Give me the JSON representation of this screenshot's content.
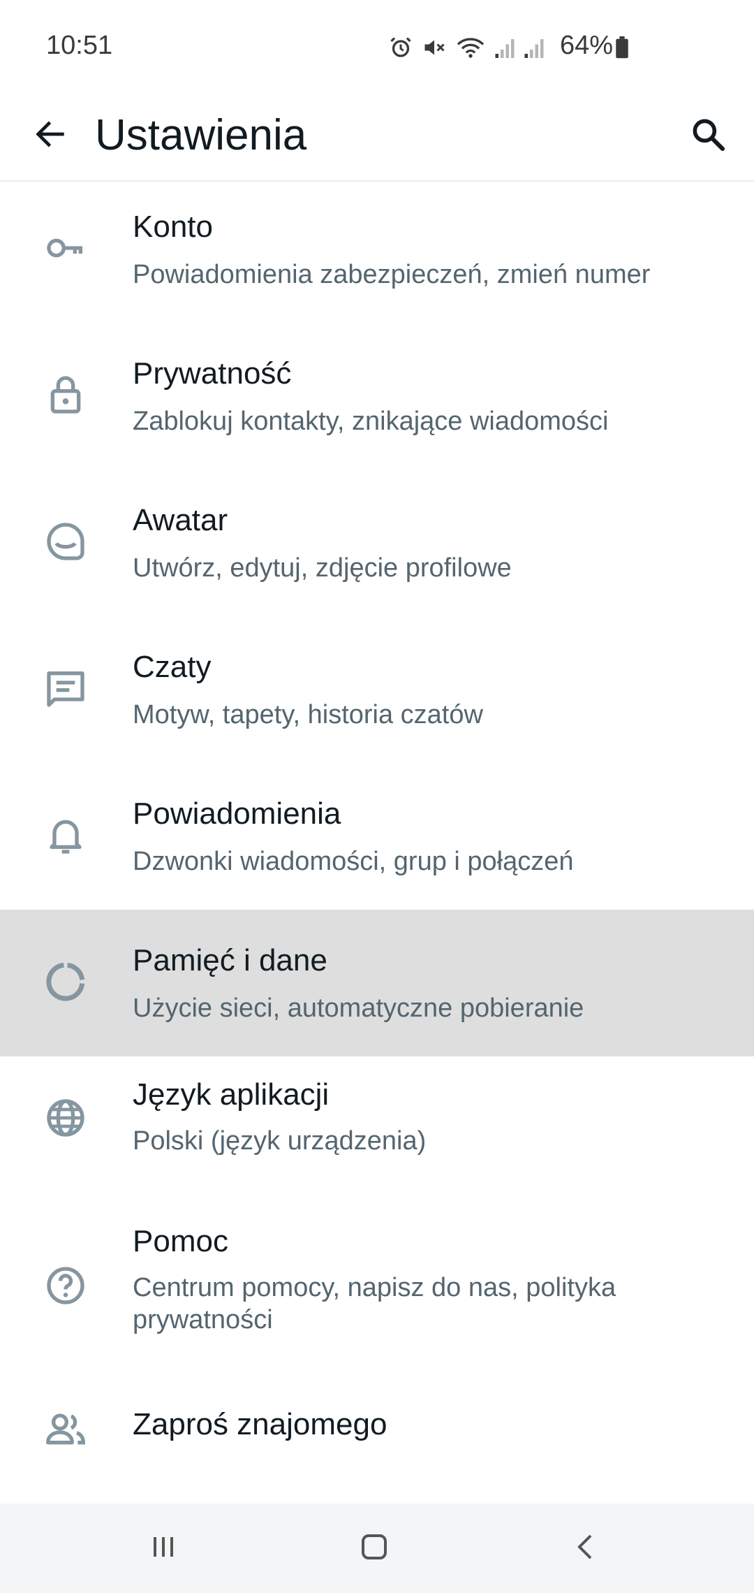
{
  "status_bar": {
    "time": "10:51",
    "battery": "64%",
    "icons": [
      "alarm-icon",
      "mute-icon",
      "wifi-icon",
      "signal-icon",
      "signal-icon",
      "battery-icon"
    ]
  },
  "app_bar": {
    "title": "Ustawienia",
    "back_icon": "arrow-left-icon",
    "search_icon": "search-icon"
  },
  "settings": [
    {
      "id": "konto",
      "icon": "key-icon",
      "title": "Konto",
      "subtitle": "Powiadomienia zabezpieczeń, zmień numer"
    },
    {
      "id": "prywatnosc",
      "icon": "lock-icon",
      "title": "Prywatność",
      "subtitle": "Zablokuj kontakty, znikające wiadomości"
    },
    {
      "id": "awatar",
      "icon": "avatar-icon",
      "title": "Awatar",
      "subtitle": "Utwórz, edytuj, zdjęcie profilowe"
    },
    {
      "id": "czaty",
      "icon": "chat-icon",
      "title": "Czaty",
      "subtitle": "Motyw, tapety, historia czatów"
    },
    {
      "id": "powiadomienia",
      "icon": "bell-icon",
      "title": "Powiadomienia",
      "subtitle": "Dzwonki wiadomości, grup i połączeń"
    },
    {
      "id": "pamiec",
      "icon": "data-usage-icon",
      "title": "Pamięć i dane",
      "subtitle": "Użycie sieci, automatyczne pobieranie",
      "highlighted": true
    },
    {
      "id": "jezyk",
      "icon": "globe-icon",
      "title": "Język aplikacji",
      "subtitle": "Polski (język urządzenia)"
    },
    {
      "id": "pomoc",
      "icon": "help-icon",
      "title": "Pomoc",
      "subtitle": "Centrum pomocy, napisz do nas, polityka prywatności"
    },
    {
      "id": "zapros",
      "icon": "people-icon",
      "title": "Zaproś znajomego",
      "subtitle": ""
    }
  ],
  "nav_bar": {
    "recents_icon": "recents-icon",
    "home_icon": "home-icon",
    "back_icon": "back-chevron-icon"
  },
  "colors": {
    "title_text": "#111b21",
    "subtitle_text": "#54656f",
    "icon_gray": "#8696a0",
    "highlight_bg": "#dedede",
    "nav_bg": "#f4f5f7"
  }
}
